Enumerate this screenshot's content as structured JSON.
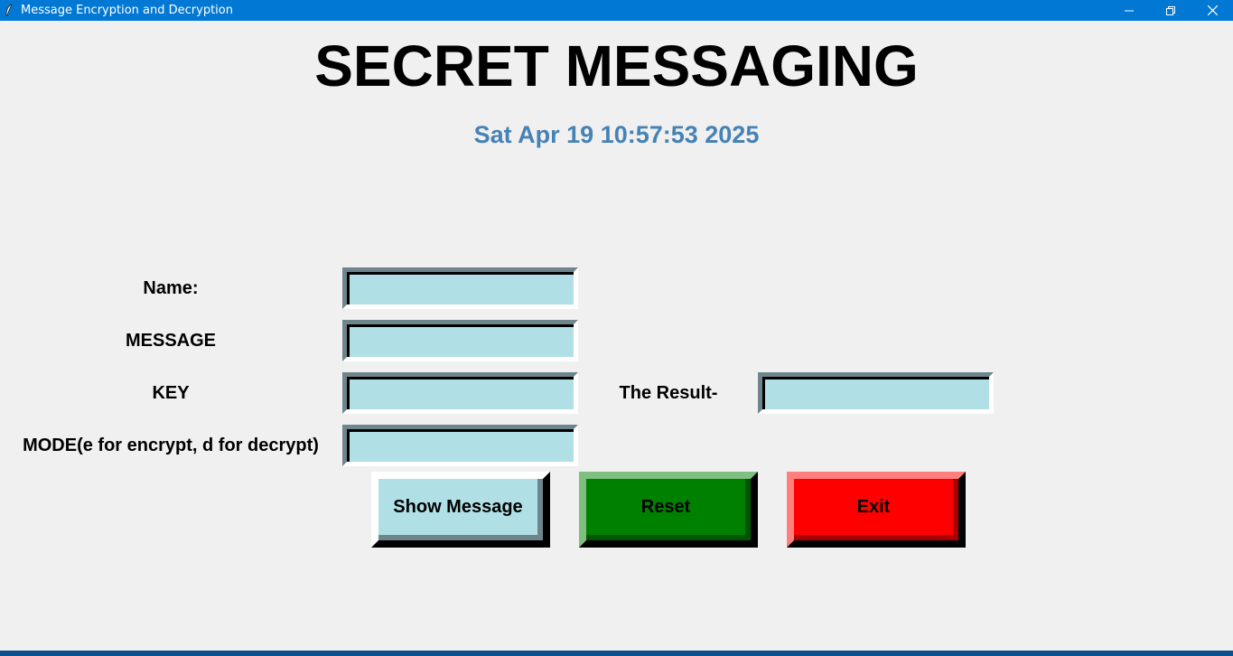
{
  "window": {
    "title": "Message Encryption and Decryption",
    "icon": "feather-icon",
    "controls": [
      "minimize-icon",
      "restore-icon",
      "close-icon"
    ]
  },
  "app": {
    "heading": "SECRET MESSAGING",
    "clock": "Sat Apr 19 10:57:53 2025"
  },
  "form": {
    "name_label": "Name:",
    "message_label": "MESSAGE",
    "key_label": "KEY",
    "mode_label": "MODE(e for encrypt, d for decrypt)",
    "result_label": "The Result-",
    "name_value": "",
    "message_value": "",
    "key_value": "",
    "mode_value": "",
    "result_value": ""
  },
  "buttons": {
    "show_message": "Show Message",
    "reset": "Reset",
    "exit": "Exit"
  },
  "colors": {
    "titlebar": "#0078d4",
    "background": "#f0f0f0",
    "clock_text": "#4682b4",
    "entry_fill": "#b0e0e6",
    "show_button": "#b0e0e6",
    "reset_button": "#008000",
    "exit_button": "#ff0000"
  }
}
